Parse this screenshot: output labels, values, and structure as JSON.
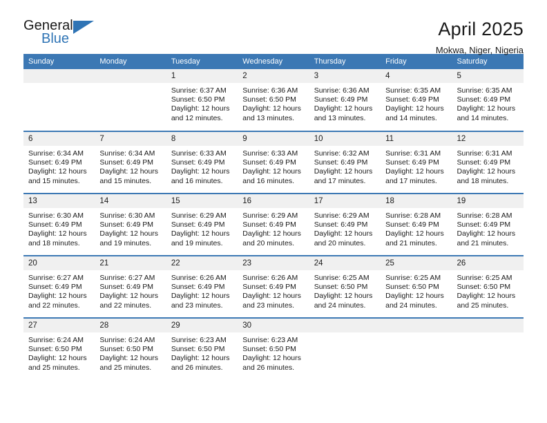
{
  "brand": {
    "name_top": "General",
    "name_bottom": "Blue",
    "triangle_icon": "triangle-icon",
    "color_blue": "#2f74b5"
  },
  "header": {
    "title": "April 2025",
    "subtitle": "Mokwa, Niger, Nigeria"
  },
  "theme": {
    "header_blue": "#3c78b4",
    "daynum_gray": "#f0f0f0",
    "text": "#1a1a1a"
  },
  "calendar": {
    "weekday_headers": [
      "Sunday",
      "Monday",
      "Tuesday",
      "Wednesday",
      "Thursday",
      "Friday",
      "Saturday"
    ],
    "weeks": [
      [
        {
          "day": "",
          "sunrise": "",
          "sunset": "",
          "daylight_1": "",
          "daylight_2": ""
        },
        {
          "day": "",
          "sunrise": "",
          "sunset": "",
          "daylight_1": "",
          "daylight_2": ""
        },
        {
          "day": "1",
          "sunrise": "Sunrise: 6:37 AM",
          "sunset": "Sunset: 6:50 PM",
          "daylight_1": "Daylight: 12 hours",
          "daylight_2": "and 12 minutes."
        },
        {
          "day": "2",
          "sunrise": "Sunrise: 6:36 AM",
          "sunset": "Sunset: 6:50 PM",
          "daylight_1": "Daylight: 12 hours",
          "daylight_2": "and 13 minutes."
        },
        {
          "day": "3",
          "sunrise": "Sunrise: 6:36 AM",
          "sunset": "Sunset: 6:49 PM",
          "daylight_1": "Daylight: 12 hours",
          "daylight_2": "and 13 minutes."
        },
        {
          "day": "4",
          "sunrise": "Sunrise: 6:35 AM",
          "sunset": "Sunset: 6:49 PM",
          "daylight_1": "Daylight: 12 hours",
          "daylight_2": "and 14 minutes."
        },
        {
          "day": "5",
          "sunrise": "Sunrise: 6:35 AM",
          "sunset": "Sunset: 6:49 PM",
          "daylight_1": "Daylight: 12 hours",
          "daylight_2": "and 14 minutes."
        }
      ],
      [
        {
          "day": "6",
          "sunrise": "Sunrise: 6:34 AM",
          "sunset": "Sunset: 6:49 PM",
          "daylight_1": "Daylight: 12 hours",
          "daylight_2": "and 15 minutes."
        },
        {
          "day": "7",
          "sunrise": "Sunrise: 6:34 AM",
          "sunset": "Sunset: 6:49 PM",
          "daylight_1": "Daylight: 12 hours",
          "daylight_2": "and 15 minutes."
        },
        {
          "day": "8",
          "sunrise": "Sunrise: 6:33 AM",
          "sunset": "Sunset: 6:49 PM",
          "daylight_1": "Daylight: 12 hours",
          "daylight_2": "and 16 minutes."
        },
        {
          "day": "9",
          "sunrise": "Sunrise: 6:33 AM",
          "sunset": "Sunset: 6:49 PM",
          "daylight_1": "Daylight: 12 hours",
          "daylight_2": "and 16 minutes."
        },
        {
          "day": "10",
          "sunrise": "Sunrise: 6:32 AM",
          "sunset": "Sunset: 6:49 PM",
          "daylight_1": "Daylight: 12 hours",
          "daylight_2": "and 17 minutes."
        },
        {
          "day": "11",
          "sunrise": "Sunrise: 6:31 AM",
          "sunset": "Sunset: 6:49 PM",
          "daylight_1": "Daylight: 12 hours",
          "daylight_2": "and 17 minutes."
        },
        {
          "day": "12",
          "sunrise": "Sunrise: 6:31 AM",
          "sunset": "Sunset: 6:49 PM",
          "daylight_1": "Daylight: 12 hours",
          "daylight_2": "and 18 minutes."
        }
      ],
      [
        {
          "day": "13",
          "sunrise": "Sunrise: 6:30 AM",
          "sunset": "Sunset: 6:49 PM",
          "daylight_1": "Daylight: 12 hours",
          "daylight_2": "and 18 minutes."
        },
        {
          "day": "14",
          "sunrise": "Sunrise: 6:30 AM",
          "sunset": "Sunset: 6:49 PM",
          "daylight_1": "Daylight: 12 hours",
          "daylight_2": "and 19 minutes."
        },
        {
          "day": "15",
          "sunrise": "Sunrise: 6:29 AM",
          "sunset": "Sunset: 6:49 PM",
          "daylight_1": "Daylight: 12 hours",
          "daylight_2": "and 19 minutes."
        },
        {
          "day": "16",
          "sunrise": "Sunrise: 6:29 AM",
          "sunset": "Sunset: 6:49 PM",
          "daylight_1": "Daylight: 12 hours",
          "daylight_2": "and 20 minutes."
        },
        {
          "day": "17",
          "sunrise": "Sunrise: 6:29 AM",
          "sunset": "Sunset: 6:49 PM",
          "daylight_1": "Daylight: 12 hours",
          "daylight_2": "and 20 minutes."
        },
        {
          "day": "18",
          "sunrise": "Sunrise: 6:28 AM",
          "sunset": "Sunset: 6:49 PM",
          "daylight_1": "Daylight: 12 hours",
          "daylight_2": "and 21 minutes."
        },
        {
          "day": "19",
          "sunrise": "Sunrise: 6:28 AM",
          "sunset": "Sunset: 6:49 PM",
          "daylight_1": "Daylight: 12 hours",
          "daylight_2": "and 21 minutes."
        }
      ],
      [
        {
          "day": "20",
          "sunrise": "Sunrise: 6:27 AM",
          "sunset": "Sunset: 6:49 PM",
          "daylight_1": "Daylight: 12 hours",
          "daylight_2": "and 22 minutes."
        },
        {
          "day": "21",
          "sunrise": "Sunrise: 6:27 AM",
          "sunset": "Sunset: 6:49 PM",
          "daylight_1": "Daylight: 12 hours",
          "daylight_2": "and 22 minutes."
        },
        {
          "day": "22",
          "sunrise": "Sunrise: 6:26 AM",
          "sunset": "Sunset: 6:49 PM",
          "daylight_1": "Daylight: 12 hours",
          "daylight_2": "and 23 minutes."
        },
        {
          "day": "23",
          "sunrise": "Sunrise: 6:26 AM",
          "sunset": "Sunset: 6:49 PM",
          "daylight_1": "Daylight: 12 hours",
          "daylight_2": "and 23 minutes."
        },
        {
          "day": "24",
          "sunrise": "Sunrise: 6:25 AM",
          "sunset": "Sunset: 6:50 PM",
          "daylight_1": "Daylight: 12 hours",
          "daylight_2": "and 24 minutes."
        },
        {
          "day": "25",
          "sunrise": "Sunrise: 6:25 AM",
          "sunset": "Sunset: 6:50 PM",
          "daylight_1": "Daylight: 12 hours",
          "daylight_2": "and 24 minutes."
        },
        {
          "day": "26",
          "sunrise": "Sunrise: 6:25 AM",
          "sunset": "Sunset: 6:50 PM",
          "daylight_1": "Daylight: 12 hours",
          "daylight_2": "and 25 minutes."
        }
      ],
      [
        {
          "day": "27",
          "sunrise": "Sunrise: 6:24 AM",
          "sunset": "Sunset: 6:50 PM",
          "daylight_1": "Daylight: 12 hours",
          "daylight_2": "and 25 minutes."
        },
        {
          "day": "28",
          "sunrise": "Sunrise: 6:24 AM",
          "sunset": "Sunset: 6:50 PM",
          "daylight_1": "Daylight: 12 hours",
          "daylight_2": "and 25 minutes."
        },
        {
          "day": "29",
          "sunrise": "Sunrise: 6:23 AM",
          "sunset": "Sunset: 6:50 PM",
          "daylight_1": "Daylight: 12 hours",
          "daylight_2": "and 26 minutes."
        },
        {
          "day": "30",
          "sunrise": "Sunrise: 6:23 AM",
          "sunset": "Sunset: 6:50 PM",
          "daylight_1": "Daylight: 12 hours",
          "daylight_2": "and 26 minutes."
        },
        {
          "day": "",
          "sunrise": "",
          "sunset": "",
          "daylight_1": "",
          "daylight_2": ""
        },
        {
          "day": "",
          "sunrise": "",
          "sunset": "",
          "daylight_1": "",
          "daylight_2": ""
        },
        {
          "day": "",
          "sunrise": "",
          "sunset": "",
          "daylight_1": "",
          "daylight_2": ""
        }
      ]
    ]
  }
}
